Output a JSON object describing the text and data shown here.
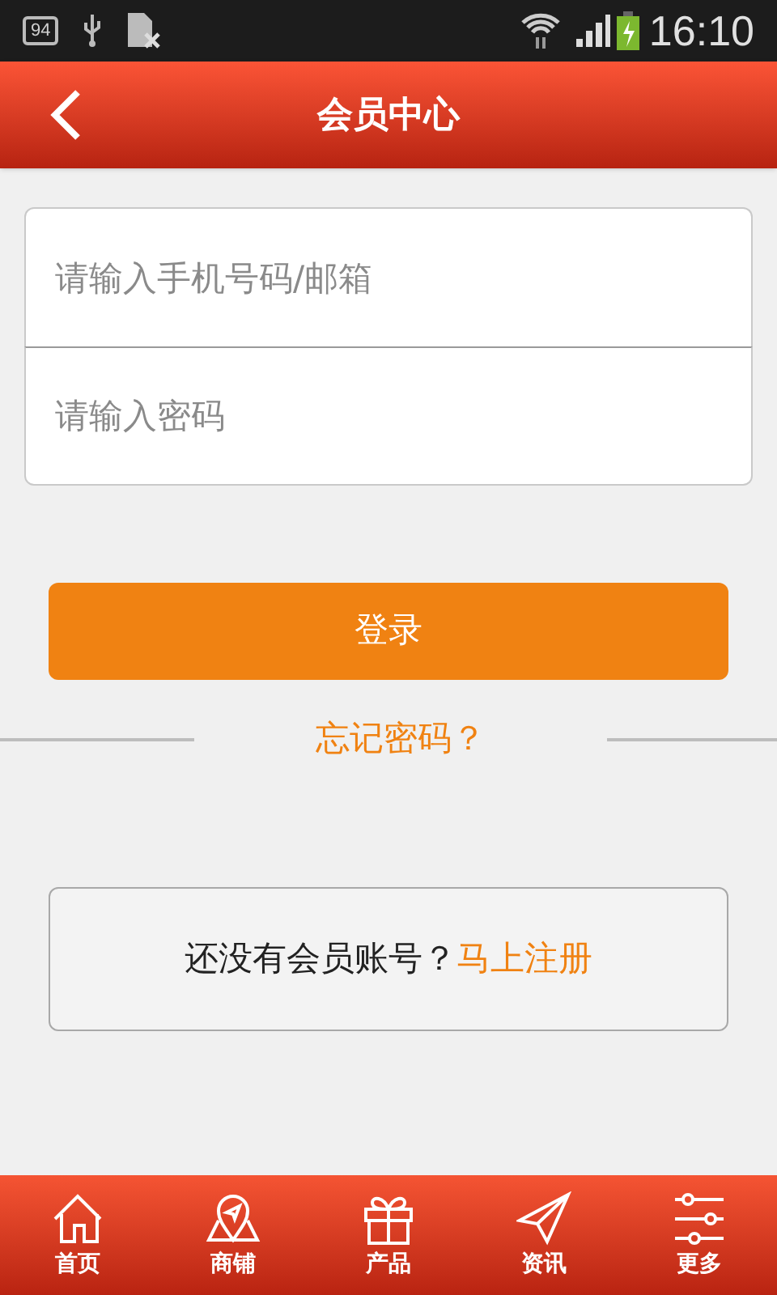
{
  "status_bar": {
    "notification_badge": "94",
    "time": "16:10"
  },
  "header": {
    "title": "会员中心"
  },
  "login_form": {
    "fields": [
      {
        "placeholder": "请输入手机号码/邮箱"
      },
      {
        "placeholder": "请输入密码"
      }
    ],
    "login_button": "登录",
    "forgot_link": "忘记密码？"
  },
  "register": {
    "prompt": "还没有会员账号？",
    "link": "马上注册"
  },
  "bottom_nav": [
    {
      "label": "首页",
      "kind": "home"
    },
    {
      "label": "商铺",
      "kind": "map"
    },
    {
      "label": "产品",
      "kind": "gift"
    },
    {
      "label": "资讯",
      "kind": "send"
    },
    {
      "label": "更多",
      "kind": "sliders"
    }
  ]
}
